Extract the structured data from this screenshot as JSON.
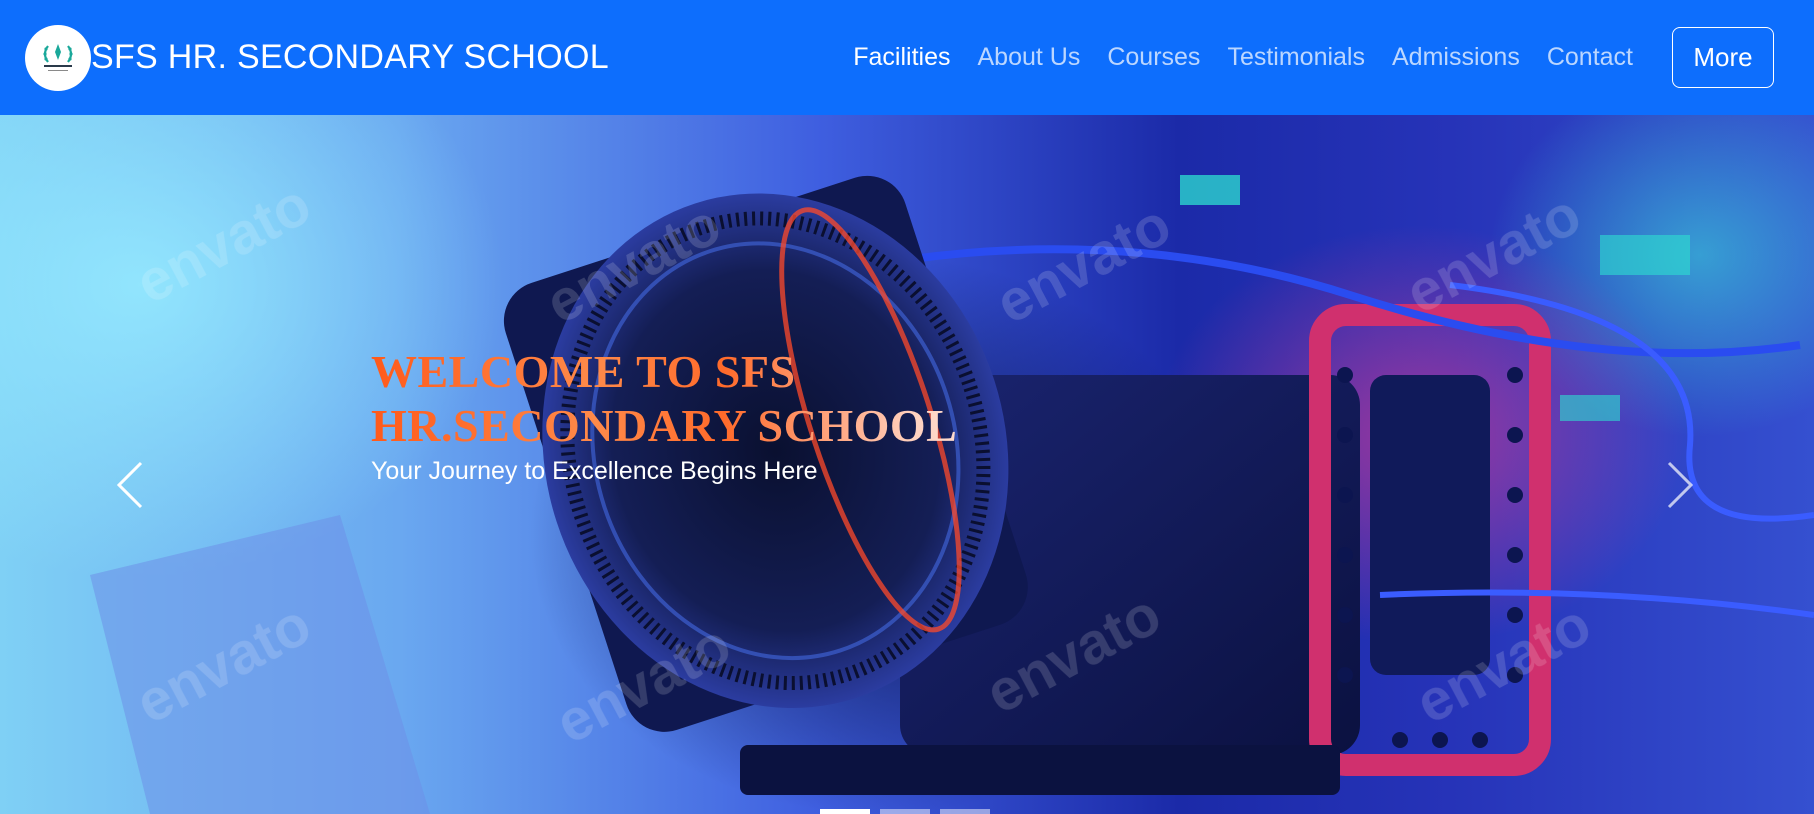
{
  "navbar": {
    "brand_name": "SFS HR. SECONDARY SCHOOL",
    "links": [
      {
        "label": "Facilities",
        "active": true
      },
      {
        "label": "About Us",
        "active": false
      },
      {
        "label": "Courses",
        "active": false
      },
      {
        "label": "Testimonials",
        "active": false
      },
      {
        "label": "Admissions",
        "active": false
      },
      {
        "label": "Contact",
        "active": false
      }
    ],
    "more_label": "More"
  },
  "hero": {
    "headline": "WELCOME TO SFS HR.SECONDARY SCHOOL",
    "subheadline": "Your Journey to Excellence Begins Here",
    "watermark_text": "envato",
    "slides_count": 3,
    "active_slide": 1
  },
  "colors": {
    "navbar_bg": "#0d6efd",
    "headline_orange": "#ff5a1a",
    "text_white": "#ffffff"
  },
  "icons": {
    "prev": "chevron-left-icon",
    "next": "chevron-right-icon"
  }
}
